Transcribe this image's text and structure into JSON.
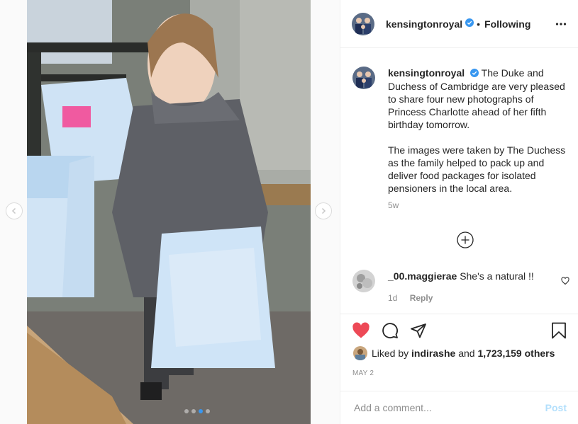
{
  "post": {
    "username": "kensingtonroyal",
    "follow_separator": "•",
    "follow_status": "Following",
    "caption_paragraph_1": "The Duke and Duchess of Cambridge are very pleased to share four new photographs of Princess Charlotte ahead of her fifth birthday tomorrow.",
    "caption_paragraph_2": "The images were taken by The Duchess as the family helped to pack up and deliver food packages for isolated pensioners in the local area.",
    "caption_age": "5w",
    "carousel": {
      "count": 4,
      "active_index": 2
    }
  },
  "comments": [
    {
      "username": "_00.maggierae",
      "text": "She's a natural !!",
      "age": "1d",
      "reply_label": "Reply"
    }
  ],
  "likes": {
    "prefix": "Liked by",
    "user": "indirashe",
    "conjunction": "and",
    "count": "1,723,159 others"
  },
  "date": "MAY 2",
  "add_comment": {
    "placeholder": "Add a comment...",
    "post_label": "Post"
  },
  "colors": {
    "like_red": "#ed4956",
    "verified_blue": "#3897f0",
    "post_disabled": "#b2dffc",
    "muted_text": "#8e8e8e"
  },
  "icons": [
    "chevron-left-icon",
    "chevron-right-icon",
    "verified-badge-icon",
    "more-options-icon",
    "add-circle-icon",
    "heart-outline-icon",
    "heart-filled-icon",
    "comment-icon",
    "share-icon",
    "bookmark-icon"
  ]
}
